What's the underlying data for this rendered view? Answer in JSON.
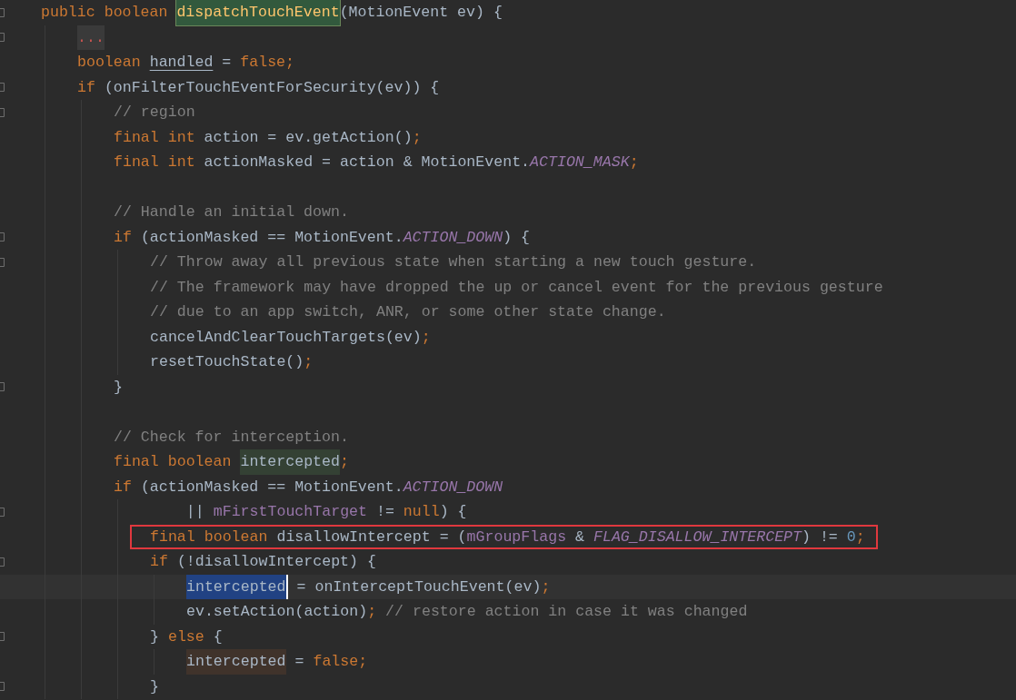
{
  "editor": {
    "lines": [
      {
        "fold": true,
        "boxed": false,
        "tokens": [
          {
            "kind": "kw",
            "text": "public boolean "
          },
          {
            "kind": "definition",
            "text": "dispatchTouchEvent"
          },
          {
            "kind": "plain",
            "text": "(MotionEvent ev) {"
          }
        ],
        "children": [
          {
            "fold": true,
            "boxed": false,
            "tokens": [
              {
                "kind": "folded",
                "text": "..."
              }
            ]
          },
          {
            "fold": false,
            "boxed": false,
            "tokens": [
              {
                "kind": "kw",
                "text": "boolean "
              },
              {
                "kind": "underlined",
                "text": "handled"
              },
              {
                "kind": "plain",
                "text": " = "
              },
              {
                "kind": "kw",
                "text": "false;"
              }
            ]
          },
          {
            "fold": true,
            "boxed": false,
            "tokens": [
              {
                "kind": "kw",
                "text": "if "
              },
              {
                "kind": "plain",
                "text": "(onFilterTouchEventForSecurity(ev)) {"
              }
            ],
            "children": [
              {
                "fold": true,
                "boxed": false,
                "tokens": [
                  {
                    "kind": "comment",
                    "text": "// region"
                  }
                ]
              },
              {
                "fold": false,
                "boxed": false,
                "tokens": [
                  {
                    "kind": "kw",
                    "text": "final int "
                  },
                  {
                    "kind": "plain",
                    "text": "action = ev.getAction()"
                  },
                  {
                    "kind": "kw",
                    "text": ";"
                  }
                ]
              },
              {
                "fold": false,
                "boxed": false,
                "tokens": [
                  {
                    "kind": "kw",
                    "text": "final int "
                  },
                  {
                    "kind": "plain",
                    "text": "actionMasked = action & MotionEvent."
                  },
                  {
                    "kind": "const",
                    "text": "ACTION_MASK"
                  },
                  {
                    "kind": "kw",
                    "text": ";"
                  }
                ]
              },
              {
                "fold": false,
                "boxed": false
              },
              {
                "fold": false,
                "boxed": false,
                "tokens": [
                  {
                    "kind": "comment",
                    "text": "// Handle an initial down."
                  }
                ]
              },
              {
                "fold": true,
                "boxed": false,
                "tokens": [
                  {
                    "kind": "kw",
                    "text": "if "
                  },
                  {
                    "kind": "plain",
                    "text": "(actionMasked == MotionEvent."
                  },
                  {
                    "kind": "const",
                    "text": "ACTION_DOWN"
                  },
                  {
                    "kind": "plain",
                    "text": ") {"
                  }
                ],
                "children": [
                  {
                    "fold": true,
                    "boxed": false,
                    "tokens": [
                      {
                        "kind": "comment",
                        "text": "// Throw away all previous state when starting a new touch gesture."
                      }
                    ]
                  },
                  {
                    "fold": false,
                    "boxed": false,
                    "tokens": [
                      {
                        "kind": "comment",
                        "text": "// The framework may have dropped the up or cancel event for the previous gesture"
                      }
                    ]
                  },
                  {
                    "fold": false,
                    "boxed": false,
                    "tokens": [
                      {
                        "kind": "comment",
                        "text": "// due to an app switch, ANR, or some other state change."
                      }
                    ]
                  },
                  {
                    "fold": false,
                    "boxed": false,
                    "tokens": [
                      {
                        "kind": "plain",
                        "text": "cancelAndClearTouchTargets(ev)"
                      },
                      {
                        "kind": "kw",
                        "text": ";"
                      }
                    ]
                  },
                  {
                    "fold": false,
                    "boxed": false,
                    "tokens": [
                      {
                        "kind": "plain",
                        "text": "resetTouchState()"
                      },
                      {
                        "kind": "kw",
                        "text": ";"
                      }
                    ]
                  }
                ]
              },
              {
                "fold": true,
                "boxed": false,
                "tokens": [
                  {
                    "kind": "plain",
                    "text": "}"
                  }
                ]
              },
              {
                "fold": false,
                "boxed": false
              },
              {
                "fold": false,
                "boxed": false,
                "tokens": [
                  {
                    "kind": "comment",
                    "text": "// Check for interception."
                  }
                ]
              },
              {
                "fold": false,
                "boxed": false,
                "tokens": [
                  {
                    "kind": "kw",
                    "text": "final boolean "
                  },
                  {
                    "kind": "read-usage",
                    "text": "intercepted"
                  },
                  {
                    "kind": "kw",
                    "text": ";"
                  }
                ]
              },
              {
                "fold": false,
                "boxed": false,
                "tokens": [
                  {
                    "kind": "kw",
                    "text": "if "
                  },
                  {
                    "kind": "plain",
                    "text": "(actionMasked == MotionEvent."
                  },
                  {
                    "kind": "const",
                    "text": "ACTION_DOWN"
                  }
                ],
                "children": [
                  {
                    "fold": true,
                    "boxed": false,
                    "tokens": [
                      {
                        "kind": "plain",
                        "text": "    || "
                      },
                      {
                        "kind": "field",
                        "text": "mFirstTouchTarget"
                      },
                      {
                        "kind": "plain",
                        "text": " != "
                      },
                      {
                        "kind": "kw",
                        "text": "null"
                      },
                      {
                        "kind": "plain",
                        "text": ") {"
                      }
                    ]
                  },
                  {
                    "fold": false,
                    "boxed": true,
                    "tokens": [
                      {
                        "kind": "kw",
                        "text": "final boolean "
                      },
                      {
                        "kind": "plain",
                        "text": "disallowIntercept = ("
                      },
                      {
                        "kind": "field",
                        "text": "mGroupFlags"
                      },
                      {
                        "kind": "plain",
                        "text": " & "
                      },
                      {
                        "kind": "const",
                        "text": "FLAG_DISALLOW_INTERCEPT"
                      },
                      {
                        "kind": "plain",
                        "text": ") != "
                      },
                      {
                        "kind": "num",
                        "text": "0"
                      },
                      {
                        "kind": "kw",
                        "text": ";"
                      }
                    ]
                  },
                  {
                    "fold": true,
                    "boxed": false,
                    "tokens": [
                      {
                        "kind": "kw",
                        "text": "if "
                      },
                      {
                        "kind": "plain",
                        "text": "(!disallowIntercept) {"
                      }
                    ],
                    "children": [
                      {
                        "fold": false,
                        "boxed": false,
                        "tokens": [
                          {
                            "kind": "selection",
                            "text": "intercepted"
                          },
                          {
                            "kind": "plain",
                            "text": " = onInterceptTouchEvent(ev)"
                          },
                          {
                            "kind": "kw",
                            "text": ";"
                          }
                        ]
                      },
                      {
                        "fold": false,
                        "boxed": false,
                        "tokens": [
                          {
                            "kind": "plain",
                            "text": "ev.setAction(action)"
                          },
                          {
                            "kind": "kw",
                            "text": "; "
                          },
                          {
                            "kind": "comment",
                            "text": "// restore action in case it was changed"
                          }
                        ]
                      }
                    ]
                  },
                  {
                    "fold": true,
                    "boxed": false,
                    "tokens": [
                      {
                        "kind": "plain",
                        "text": "} "
                      },
                      {
                        "kind": "kw",
                        "text": "else "
                      },
                      {
                        "kind": "plain",
                        "text": "{"
                      }
                    ],
                    "children": [
                      {
                        "fold": false,
                        "boxed": false,
                        "tokens": [
                          {
                            "kind": "write-usage",
                            "text": "intercepted"
                          },
                          {
                            "kind": "plain",
                            "text": " = "
                          },
                          {
                            "kind": "kw",
                            "text": "false;"
                          }
                        ]
                      }
                    ]
                  },
                  {
                    "fold": true,
                    "boxed": false,
                    "tokens": [
                      {
                        "kind": "plain",
                        "text": "}"
                      }
                    ]
                  }
                ]
              }
            ]
          }
        ]
      }
    ]
  }
}
